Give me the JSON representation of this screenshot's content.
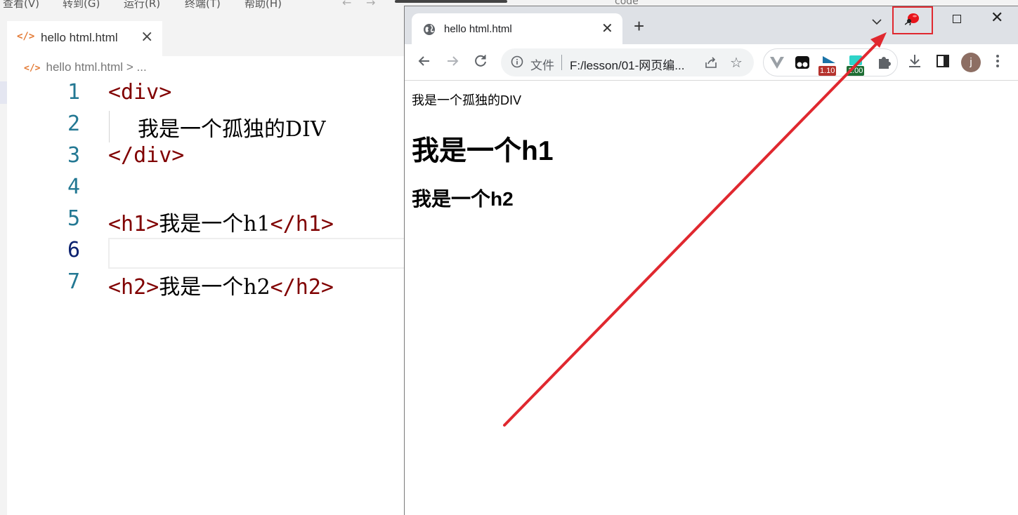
{
  "vscode": {
    "menu": [
      "查看(V)",
      "转到(G)",
      "运行(R)",
      "终端(T)",
      "帮助(H)"
    ],
    "command_center": "code",
    "tab": {
      "label": "hello html.html"
    },
    "breadcrumb": {
      "file": "hello html.html",
      "separator": ">",
      "more": "..."
    },
    "lines": [
      {
        "no": "1",
        "tag_open": "<div>",
        "text": "",
        "tag_close": ""
      },
      {
        "no": "2",
        "tag_open": "",
        "text": "我是一个孤独的DIV",
        "tag_close": ""
      },
      {
        "no": "3",
        "tag_open": "</div>",
        "text": "",
        "tag_close": ""
      },
      {
        "no": "4",
        "tag_open": "",
        "text": "",
        "tag_close": ""
      },
      {
        "no": "5",
        "tag_open": "<h1>",
        "text": "我是一个h1",
        "tag_close": "</h1>"
      },
      {
        "no": "6",
        "tag_open": "",
        "text": "",
        "tag_close": ""
      },
      {
        "no": "7",
        "tag_open": "<h2>",
        "text": "我是一个h2",
        "tag_close": "</h2>"
      }
    ],
    "colors": {
      "tag": "#800000",
      "line_number": "#237893",
      "active_line_number": "#0b216f",
      "file_icon": "#e37933"
    }
  },
  "chrome": {
    "tab": {
      "title": "hello html.html",
      "icon": "globe-icon"
    },
    "omnibox": {
      "scheme": "文件",
      "url": "F:/lesson/01-网页编..."
    },
    "extensions": [
      {
        "name": "vue-devtools-icon",
        "badge": ""
      },
      {
        "name": "tampermonkey-icon",
        "badge": ""
      },
      {
        "name": "media-extension-icon",
        "badge": "1.10",
        "badge_color": "#b5322d"
      },
      {
        "name": "speed-extension-icon",
        "badge": "1.00",
        "badge_color": "#1e6e34"
      },
      {
        "name": "puzzle-icon",
        "badge": ""
      }
    ],
    "profile": {
      "initial": "j"
    },
    "page": {
      "div_text": "我是一个孤独的DIV",
      "h1_text": "我是一个h1",
      "h2_text": "我是一个h2"
    }
  },
  "annotation": {
    "color": "#e0282f"
  }
}
